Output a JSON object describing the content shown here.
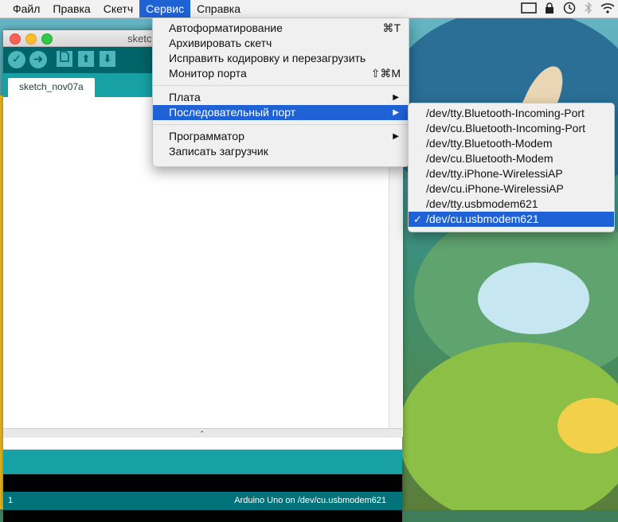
{
  "menubar": {
    "items": [
      {
        "label": "Файл"
      },
      {
        "label": "Правка"
      },
      {
        "label": "Скетч"
      },
      {
        "label": "Сервис"
      },
      {
        "label": "Справка"
      }
    ]
  },
  "status_icons": [
    "display-icon",
    "lock-icon",
    "time-machine-icon",
    "bluetooth-icon",
    "wifi-icon"
  ],
  "window": {
    "title": "sketch",
    "tab_label": "sketch_nov07a",
    "status_line": "1",
    "status_board": "Arduino Uno on /dev/cu.usbmodem621",
    "toolbar_icons": [
      "verify-icon",
      "upload-icon",
      "new-icon",
      "open-icon",
      "save-icon"
    ]
  },
  "tools_menu": {
    "items": [
      {
        "label": "Автоформатирование",
        "shortcut": "⌘T"
      },
      {
        "label": "Архивировать скетч",
        "shortcut": ""
      },
      {
        "label": "Исправить кодировку и перезагрузить",
        "shortcut": ""
      },
      {
        "label": "Монитор порта",
        "shortcut": "⇧⌘M"
      },
      {
        "label": "Плата",
        "shortcut": ""
      },
      {
        "label": "Последовательный порт",
        "shortcut": ""
      },
      {
        "label": "Программатор",
        "shortcut": ""
      },
      {
        "label": "Записать загрузчик",
        "shortcut": ""
      }
    ],
    "arrow": "▶"
  },
  "ports_menu": {
    "items": [
      "/dev/tty.Bluetooth-Incoming-Port",
      "/dev/cu.Bluetooth-Incoming-Port",
      "/dev/tty.Bluetooth-Modem",
      "/dev/cu.Bluetooth-Modem",
      "/dev/tty.iPhone-WirelessiAP",
      "/dev/cu.iPhone-WirelessiAP",
      "/dev/tty.usbmodem621",
      "/dev/cu.usbmodem621"
    ],
    "selected_index": 7,
    "check": "✓"
  },
  "colors": {
    "accent": "#1f62d6",
    "toolbar": "#006468",
    "tabbar": "#17a1a5",
    "statusbar": "#00737a"
  }
}
